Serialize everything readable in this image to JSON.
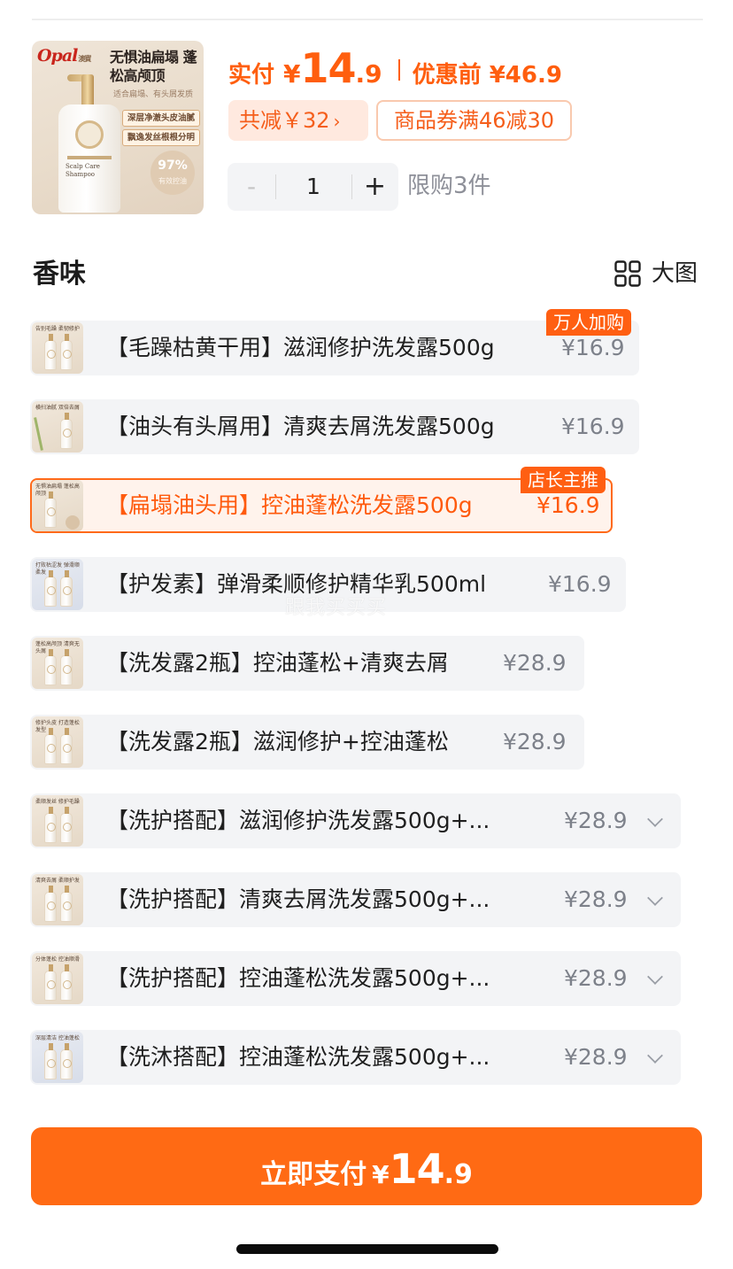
{
  "product": {
    "brand": "Opal",
    "brand_sub": "澳寶",
    "image_title": "无惧油扁塌 蓬松高颅顶",
    "image_subtitle": "适合扁塌、有头屑发质",
    "image_pill_1": "深层净澈头皮油腻",
    "image_pill_2": "飘逸发丝根根分明",
    "image_bottle_label": "Scalp Care Shampoo",
    "image_badge_pct": "97%",
    "image_badge_text": "有效控油"
  },
  "price": {
    "label": "实付",
    "currency": "¥",
    "int": "14",
    "dec": ".9",
    "original": "优惠前 ¥46.9"
  },
  "discount": {
    "saving": "共减￥32",
    "saving_chevron": "›",
    "coupon": "商品券满46减30"
  },
  "quantity": {
    "minus": "-",
    "value": "1",
    "plus": "+",
    "limit": "限购3件"
  },
  "section": {
    "title": "香味",
    "big_view": "大图"
  },
  "options": [
    {
      "label": "【毛躁枯黄干用】滋润修护洗发露500g",
      "price": "¥16.9",
      "tag": "万人加购",
      "thumb_text": "告别毛躁 柔韧修护"
    },
    {
      "label": "【油头有头屑用】清爽去屑洗发露500g",
      "price": "¥16.9",
      "thumb_text": "横扫油腻 双倍去屑"
    },
    {
      "label": "【扁塌油头用】控油蓬松洗发露500g",
      "price": "¥16.9",
      "tag": "店长主推",
      "thumb_text": "无惧油扁塌 蓬松高颅顶"
    },
    {
      "label": "【护发素】弹滑柔顺修护精华乳500ml",
      "price": "¥16.9",
      "thumb_text": "打败枯涩发 弹滑顺柔发"
    },
    {
      "label": "【洗发露2瓶】控油蓬松+清爽去屑",
      "price": "¥28.9",
      "thumb_text": "蓬松高颅顶 清爽无头屑"
    },
    {
      "label": "【洗发露2瓶】滋润修护+控油蓬松",
      "price": "¥28.9",
      "thumb_text": "修护头皮 打造蓬松发型"
    },
    {
      "label": "【洗护搭配】滋润修护洗发露500g+...",
      "price": "¥28.9",
      "thumb_text": "柔顺发丝 修护毛躁"
    },
    {
      "label": "【洗护搭配】清爽去屑洗发露500g+...",
      "price": "¥28.9",
      "thumb_text": "清爽去屑 柔顺护发"
    },
    {
      "label": "【洗护搭配】控油蓬松洗发露500g+...",
      "price": "¥28.9",
      "thumb_text": "分体蓬松 控油顺滑"
    },
    {
      "label": "【洗沐搭配】控油蓬松洗发露500g+...",
      "price": "¥28.9",
      "thumb_text": "深层清洁 控油蓬松"
    }
  ],
  "watermark": "跟我买买买",
  "pay": {
    "label": "立即支付",
    "currency": "¥",
    "int": "14",
    "dec": ".9"
  },
  "colors": {
    "accent": "#ff6a14",
    "price": "#ff5e0e",
    "row_bg": "#f3f4f6",
    "muted": "#8e9099"
  }
}
